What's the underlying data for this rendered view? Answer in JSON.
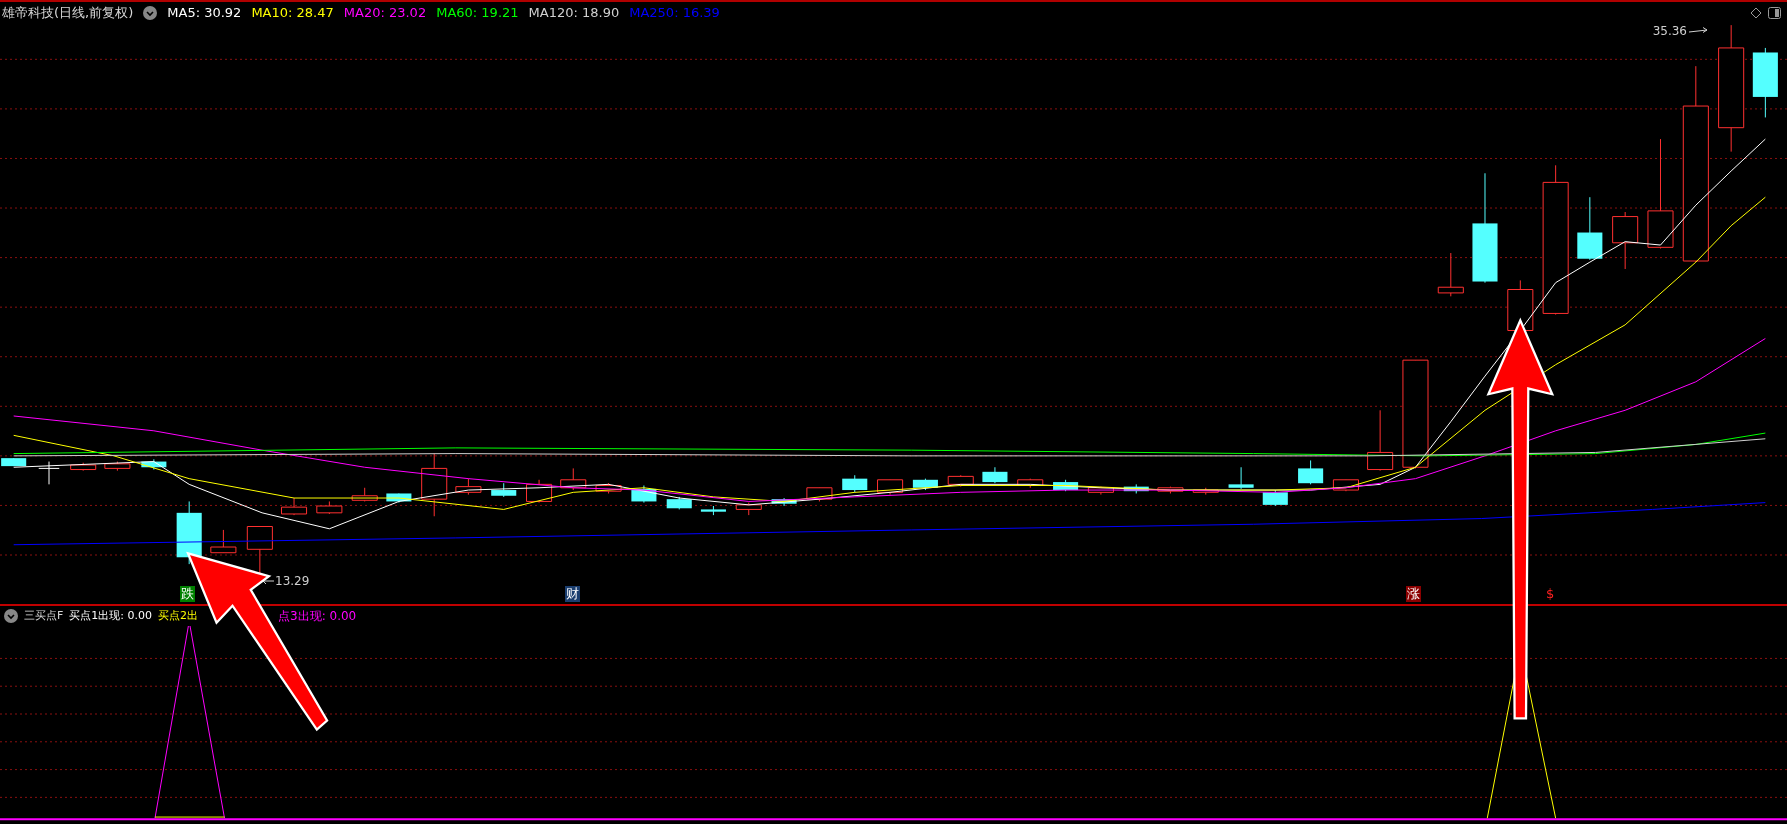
{
  "header": {
    "title": "雄帝科技(日线,前复权)",
    "ma": [
      {
        "label": "MA5: 30.92",
        "color": "#ffffff"
      },
      {
        "label": "MA10: 28.47",
        "color": "#ffff00"
      },
      {
        "label": "MA20: 23.02",
        "color": "#ff00ff"
      },
      {
        "label": "MA60: 19.21",
        "color": "#00ff00"
      },
      {
        "label": "MA120: 18.90",
        "color": "#d0d0d0"
      },
      {
        "label": "MA250: 16.39",
        "color": "#0000ff"
      }
    ]
  },
  "price_labels": [
    {
      "text": "35.36",
      "kind": "high"
    },
    {
      "text": "13.29",
      "kind": "low"
    }
  ],
  "markers": [
    {
      "text": "跌",
      "kind": "badge",
      "color": "#008000"
    },
    {
      "text": "财",
      "kind": "badge",
      "color": "#1a3d6e"
    },
    {
      "text": "涨",
      "kind": "badge",
      "color": "#8b0000"
    },
    {
      "text": "$",
      "kind": "plain",
      "color": "#ff2020"
    }
  ],
  "indicator": {
    "name": "三买点F",
    "values": [
      {
        "label": "买点1出现: 0.00",
        "color": "#ffffff"
      },
      {
        "label": "买点2出",
        "color": "#ffff00"
      },
      {
        "label": "点3出现: 0.00",
        "color": "#ff00ff"
      }
    ]
  }
}
